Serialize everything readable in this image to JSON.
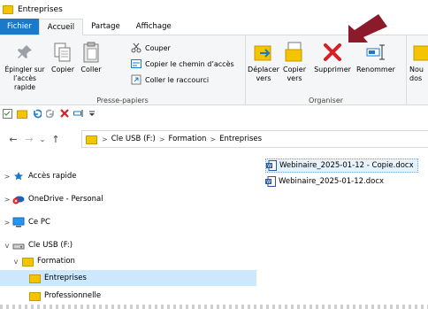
{
  "window": {
    "title": "Entreprises"
  },
  "ribbon_tabs": {
    "file": "Fichier",
    "home": "Accueil",
    "share": "Partage",
    "view": "Affichage"
  },
  "clipboard": {
    "pin": "Épingler sur l’accès rapide",
    "copy": "Copier",
    "paste": "Coller",
    "cut": "Couper",
    "copy_path": "Copier le chemin d’accès",
    "paste_shortcut": "Coller le raccourci",
    "group_label": "Presse-papiers"
  },
  "organize": {
    "move_to": "Déplacer vers",
    "copy_to": "Copier vers",
    "delete": "Supprimer",
    "rename": "Renommer",
    "group_label": "Organiser",
    "new_folder_partial": "Nou dos"
  },
  "address": {
    "segments": [
      "Cle USB (F:)",
      "Formation",
      "Entreprises"
    ],
    "separator": ">"
  },
  "nav_tree": [
    {
      "label": "Accès rapide",
      "chev": ">",
      "icon": "star-icon"
    },
    {
      "label": "OneDrive - Personal",
      "chev": ">",
      "icon": "cloud-icon"
    },
    {
      "label": "Ce PC",
      "chev": ">",
      "icon": "monitor-icon"
    },
    {
      "label": "Cle USB (F:)",
      "chev": "v",
      "icon": "drive-icon"
    },
    {
      "label": "Formation",
      "chev": "v",
      "icon": "folder-icon"
    },
    {
      "label": "Entreprises",
      "chev": "",
      "icon": "folder-icon"
    },
    {
      "label": "Professionnelle",
      "chev": "",
      "icon": "folder-icon"
    }
  ],
  "files": [
    {
      "name": "Webinaire_2025-01-12 - Copie.docx"
    },
    {
      "name": "Webinaire_2025-01-12.docx"
    }
  ],
  "colors": {
    "accent": "#1979ca",
    "delete_red": "#d61f26",
    "arrow": "#8b1a2b",
    "folder": "#f5c400",
    "selection": "#cce8ff"
  }
}
